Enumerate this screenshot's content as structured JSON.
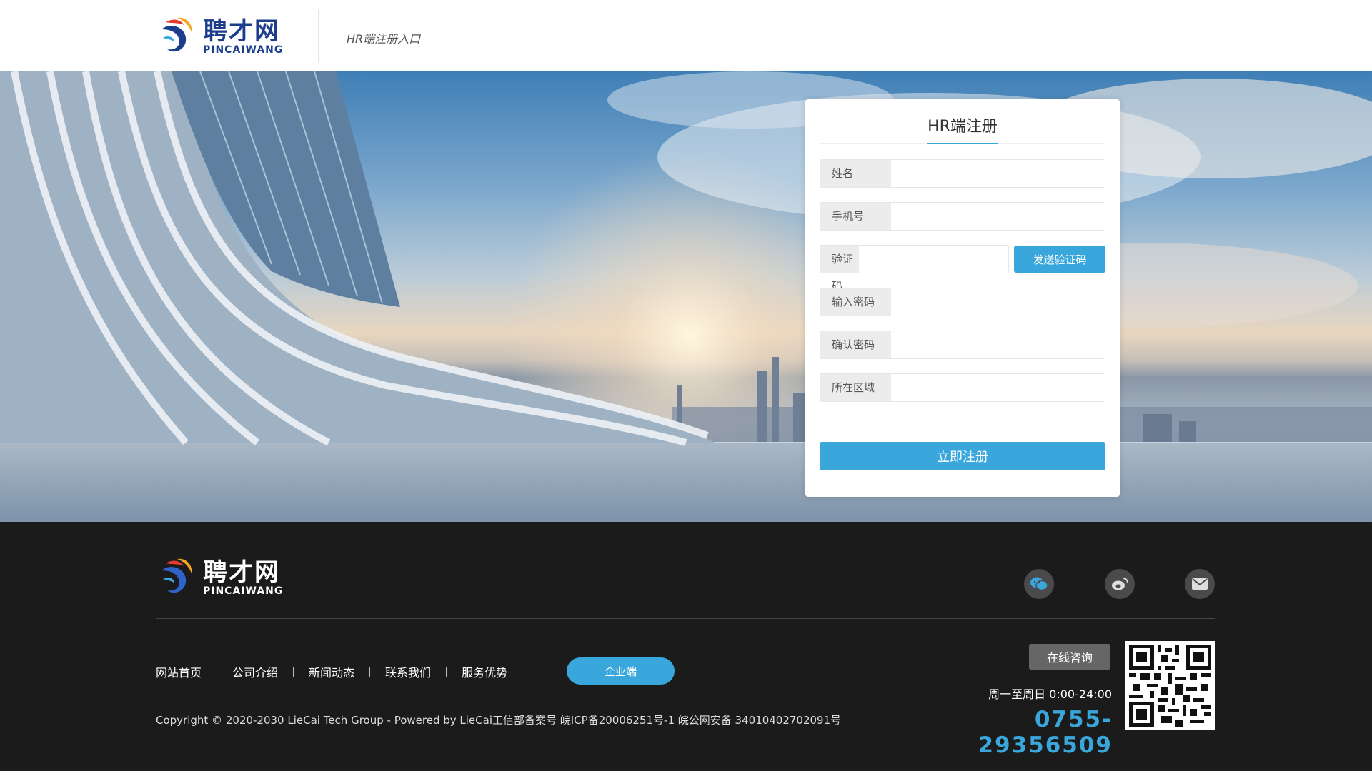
{
  "header": {
    "logo_cn": "聘才网",
    "logo_en": "PINCAIWANG",
    "subtitle": "HR端注册入口"
  },
  "form": {
    "title": "HR端注册",
    "fields": [
      {
        "label": "姓名",
        "value": ""
      },
      {
        "label": "手机号",
        "value": ""
      },
      {
        "label": "验证码",
        "value": ""
      },
      {
        "label": "输入密码",
        "value": ""
      },
      {
        "label": "确认密码",
        "value": ""
      },
      {
        "label": "所在区域",
        "value": ""
      }
    ],
    "send_code_label": "发送验证码",
    "submit_label": "立即注册"
  },
  "footer": {
    "logo_cn": "聘才网",
    "logo_en": "PINCAIWANG",
    "nav": [
      "网站首页",
      "公司介绍",
      "新闻动态",
      "联系我们",
      "服务优势"
    ],
    "enterprise_label": "企业端",
    "copyright": "Copyright © 2020-2030 LieCai Tech Group - Powered by LieCai工信部备案号 皖ICP备20006251号-1 皖公网安备 34010402702091号",
    "consult_label": "在线咨询",
    "hours": "周一至周日 0:00-24:00",
    "phone": "0755-29356509",
    "social_icons": [
      "wechat-icon",
      "weibo-icon",
      "mail-icon"
    ]
  },
  "colors": {
    "accent": "#3aa7dc",
    "brand": "#1b3d8c",
    "footer_bg": "#1b1b1c"
  }
}
